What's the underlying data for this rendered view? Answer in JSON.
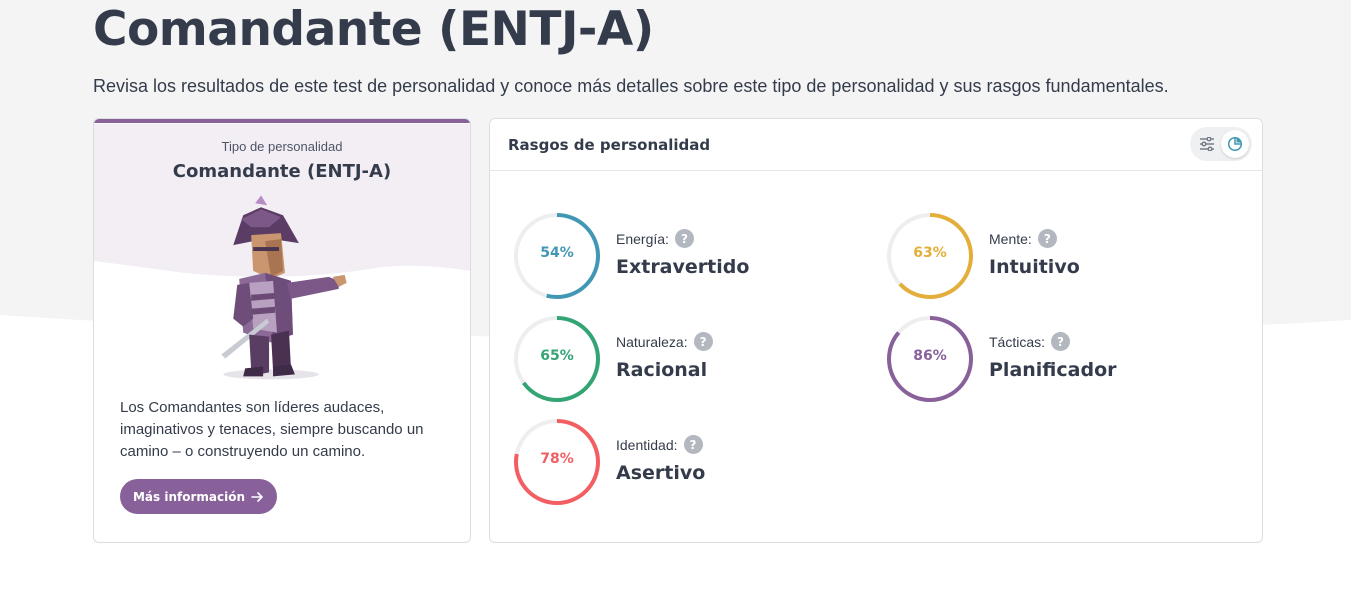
{
  "header": {
    "title": "Comandante (ENTJ-A)",
    "subtitle": "Revisa los resultados de este test de personalidad y conoce más detalles sobre este tipo de personalidad y sus rasgos fundamentales."
  },
  "type_card": {
    "kicker": "Tipo de personalidad",
    "name": "Comandante (ENTJ-A)",
    "description": "Los Comandantes son líderes audaces, imaginativos y tenaces, siempre buscando un camino – o construyendo un camino.",
    "button_label": "Más información",
    "button_icon": "arrow-right-icon",
    "accent_color": "#88619a"
  },
  "traits_card": {
    "title": "Rasgos de personalidad",
    "toggle": {
      "options": [
        "sliders-icon",
        "pie-chart-icon"
      ],
      "selected": "pie-chart-icon"
    },
    "traits": [
      {
        "label": "Energía:",
        "percent": 54,
        "percent_text": "54%",
        "value": "Extravertido",
        "color": "#4298b4"
      },
      {
        "label": "Mente:",
        "percent": 63,
        "percent_text": "63%",
        "value": "Intuitivo",
        "color": "#e4ae3a"
      },
      {
        "label": "Naturaleza:",
        "percent": 65,
        "percent_text": "65%",
        "value": "Racional",
        "color": "#33a474"
      },
      {
        "label": "Tácticas:",
        "percent": 86,
        "percent_text": "86%",
        "value": "Planificador",
        "color": "#88619a"
      },
      {
        "label": "Identidad:",
        "percent": 78,
        "percent_text": "78%",
        "value": "Asertivo",
        "color": "#f25e62"
      }
    ],
    "help_glyph": "?"
  }
}
